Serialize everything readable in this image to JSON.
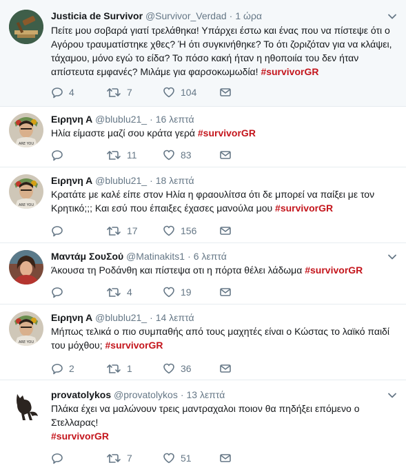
{
  "tweets": [
    {
      "name": "Justicia de Survivor",
      "handle": "@Survivor_Verdad",
      "time": "1 ώρα",
      "text": "Πείτε μου σοβαρά γιατί τρελάθηκα! Υπάρχει έστω και ένας που να πίστεψε ότι ο Αγόρου τραυματίστηκε χθες? Ή ότι συγκινήθηκε? Το ότι ζοριζόταν για να κλάψει, τάχαμου, μόνο εγώ το είδα? Το πόσο κακή ήταν η ηθοποιία του δεν ήταν απίστευτα εμφανές? Μιλάμε για φαρσοκωμωδία!",
      "hashtag": "#survivorGR",
      "replies": "4",
      "retweets": "7",
      "likes": "104",
      "avatar_icon": "gavel-icon"
    },
    {
      "name": "Ειρηνη Α",
      "handle": "@blublu21_",
      "time": "16 λεπτά",
      "text": "Ηλία είμαστε μαζί σου κράτα γερά",
      "hashtag": "#survivorGR",
      "replies": "",
      "retweets": "11",
      "likes": "83",
      "avatar_icon": "frida-portrait-icon"
    },
    {
      "name": "Ειρηνη Α",
      "handle": "@blublu21_",
      "time": "18 λεπτά",
      "text": "Κρατάτε με καλέ είπε στον Ηλία η φραουλίτσα ότι δε μπορεί να παίξει με τον Κρητικό;;; Και εσύ που έπαιξες έχασες μανούλα μου",
      "hashtag": "#survivorGR",
      "replies": "",
      "retweets": "17",
      "likes": "156",
      "avatar_icon": "frida-portrait-icon"
    },
    {
      "name": "Μαντάμ ΣουΣού",
      "handle": "@Matinakits1",
      "time": "6 λεπτά",
      "text": "Άκουσα τη Ροδάνθη και πίστεψα οτι η πόρτα θέλει λάδωμα",
      "hashtag": "#survivorGR",
      "replies": "",
      "retweets": "4",
      "likes": "19",
      "avatar_icon": "woman-portrait-icon"
    },
    {
      "name": "Ειρηνη Α",
      "handle": "@blublu21_",
      "time": "14 λεπτά",
      "text": "Μήπως τελικά ο πιο συμπαθής από τους μαχητές είναι ο Κώστας το λαϊκό παιδί του μόχθου;",
      "hashtag": "#survivorGR",
      "replies": "2",
      "retweets": "1",
      "likes": "36",
      "avatar_icon": "frida-portrait-icon"
    },
    {
      "name": "provatolykos",
      "handle": "@provatolykos",
      "time": "13 λεπτά",
      "text": "Πλάκα έχει να μαλώνουν τρεις μαντραχαλοι ποιον θα πηδήξει επόμενο ο Στελλαρας!",
      "hashtag": "#survivorGR",
      "replies": "",
      "retweets": "7",
      "likes": "51",
      "avatar_icon": "wolf-silhouette-icon"
    }
  ],
  "icons": {
    "reply": "reply-icon",
    "retweet": "retweet-icon",
    "like": "heart-icon",
    "dm": "envelope-icon",
    "caret": "chevron-down-icon"
  },
  "colors": {
    "hashtag": "#c4151c",
    "muted": "#657786",
    "highlight_bg": "#f5f8fa",
    "divider": "#e6ecf0"
  }
}
